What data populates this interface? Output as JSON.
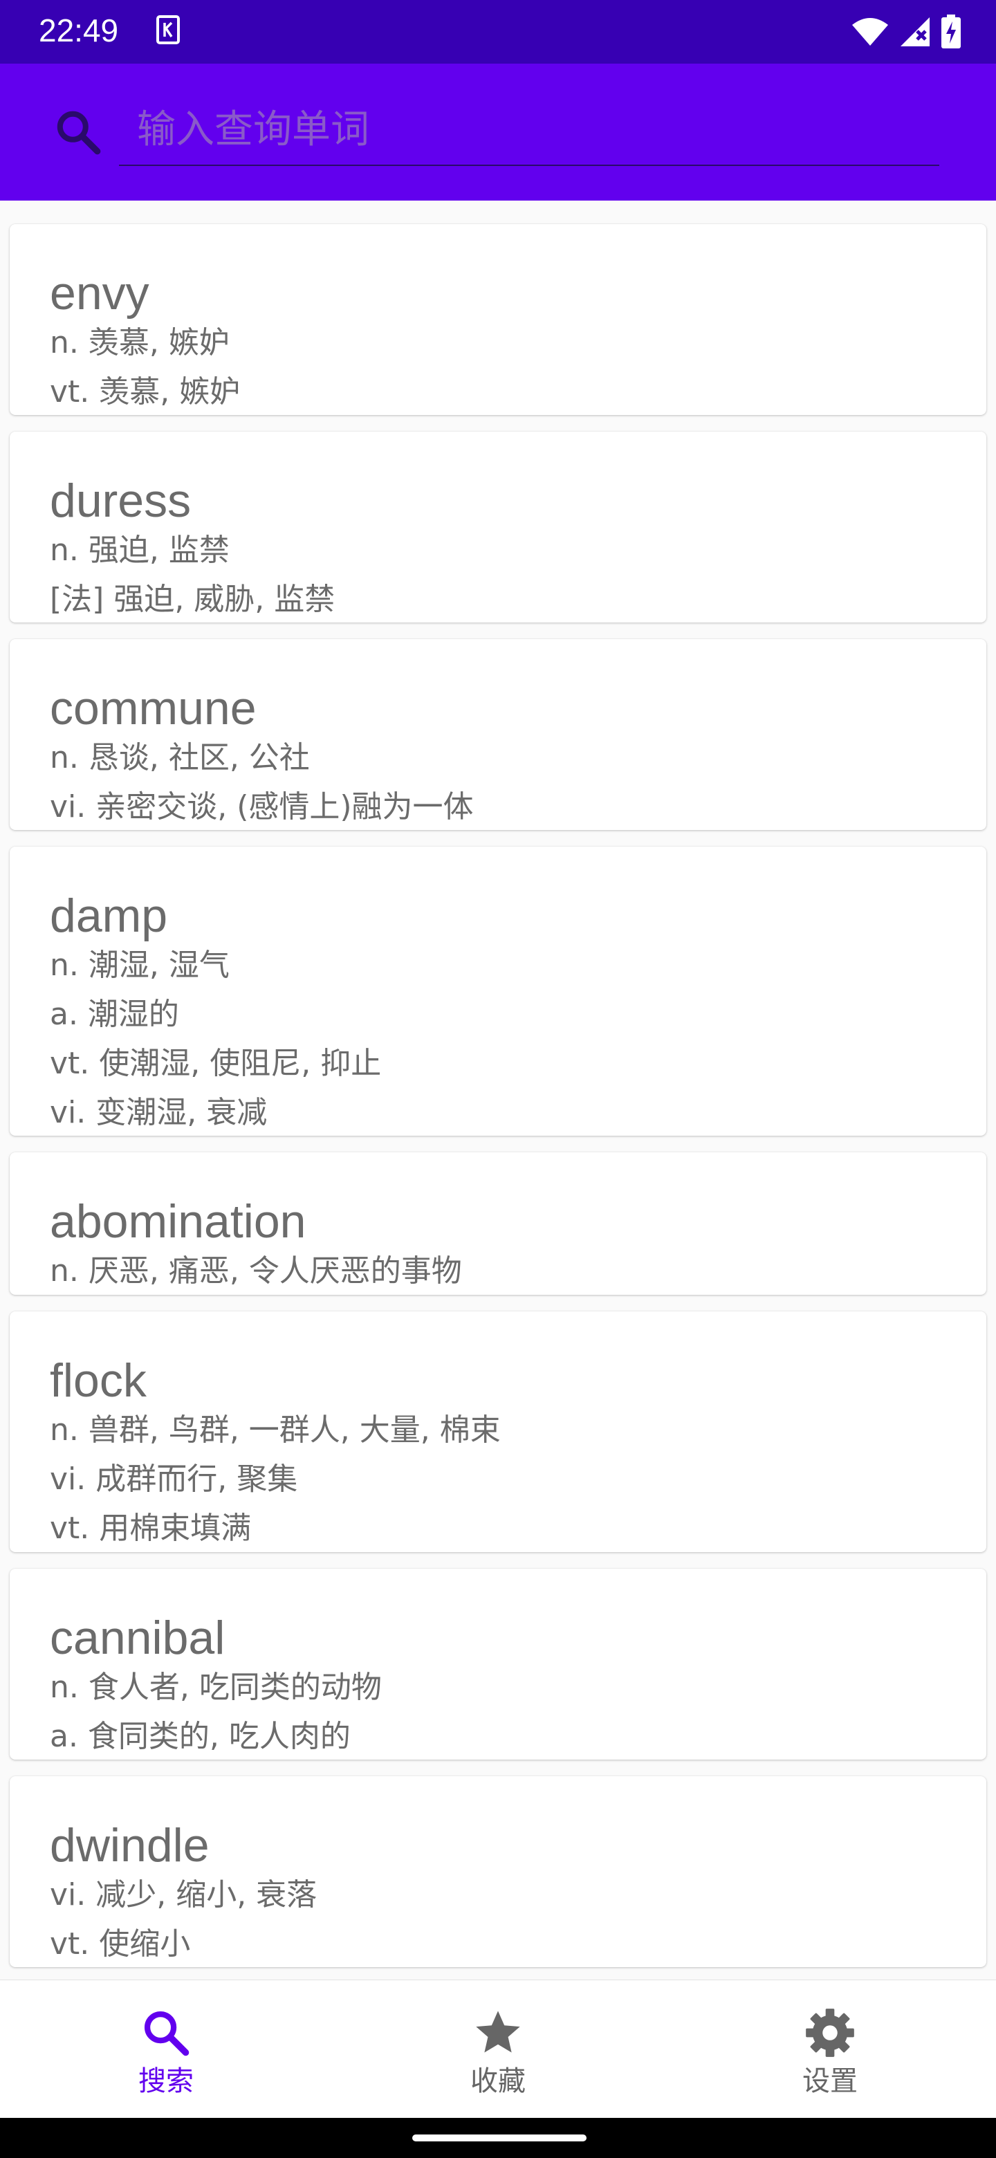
{
  "status_bar": {
    "time": "22:49",
    "notification_icon": "k-app-icon",
    "right_icons": [
      "wifi-icon",
      "signal-icon",
      "battery-charging-icon"
    ]
  },
  "search": {
    "placeholder": "输入查询单词",
    "value": "",
    "icon": "search-icon"
  },
  "words": [
    {
      "word": "envy",
      "definitions": [
        "n. 羡慕, 嫉妒",
        "vt. 羡慕, 嫉妒"
      ]
    },
    {
      "word": "duress",
      "definitions": [
        "n. 强迫, 监禁",
        "[法] 强迫, 威胁, 监禁"
      ]
    },
    {
      "word": "commune",
      "definitions": [
        "n. 恳谈, 社区, 公社",
        "vi. 亲密交谈, (感情上)融为一体"
      ]
    },
    {
      "word": "damp",
      "definitions": [
        "n. 潮湿, 湿气",
        "a. 潮湿的",
        "vt. 使潮湿, 使阻尼, 抑止",
        "vi. 变潮湿, 衰减"
      ]
    },
    {
      "word": "abomination",
      "definitions": [
        "n. 厌恶, 痛恶, 令人厌恶的事物"
      ]
    },
    {
      "word": "flock",
      "definitions": [
        "n. 兽群, 鸟群, 一群人, 大量, 棉束",
        "vi. 成群而行, 聚集",
        "vt. 用棉束填满"
      ]
    },
    {
      "word": "cannibal",
      "definitions": [
        "n. 食人者, 吃同类的动物",
        "a. 食同类的, 吃人肉的"
      ]
    },
    {
      "word": "dwindle",
      "definitions": [
        "vi. 减少, 缩小, 衰落",
        "vt. 使缩小"
      ]
    }
  ],
  "bottom_nav": {
    "tabs": [
      {
        "label": "搜索",
        "icon": "search-icon",
        "active": true
      },
      {
        "label": "收藏",
        "icon": "star-icon",
        "active": false
      },
      {
        "label": "设置",
        "icon": "gear-icon",
        "active": false
      }
    ]
  },
  "colors": {
    "status_bar": "#3700b3",
    "app_bar": "#6200ee",
    "accent": "#6200ee",
    "text_secondary": "#6b6b6b"
  }
}
